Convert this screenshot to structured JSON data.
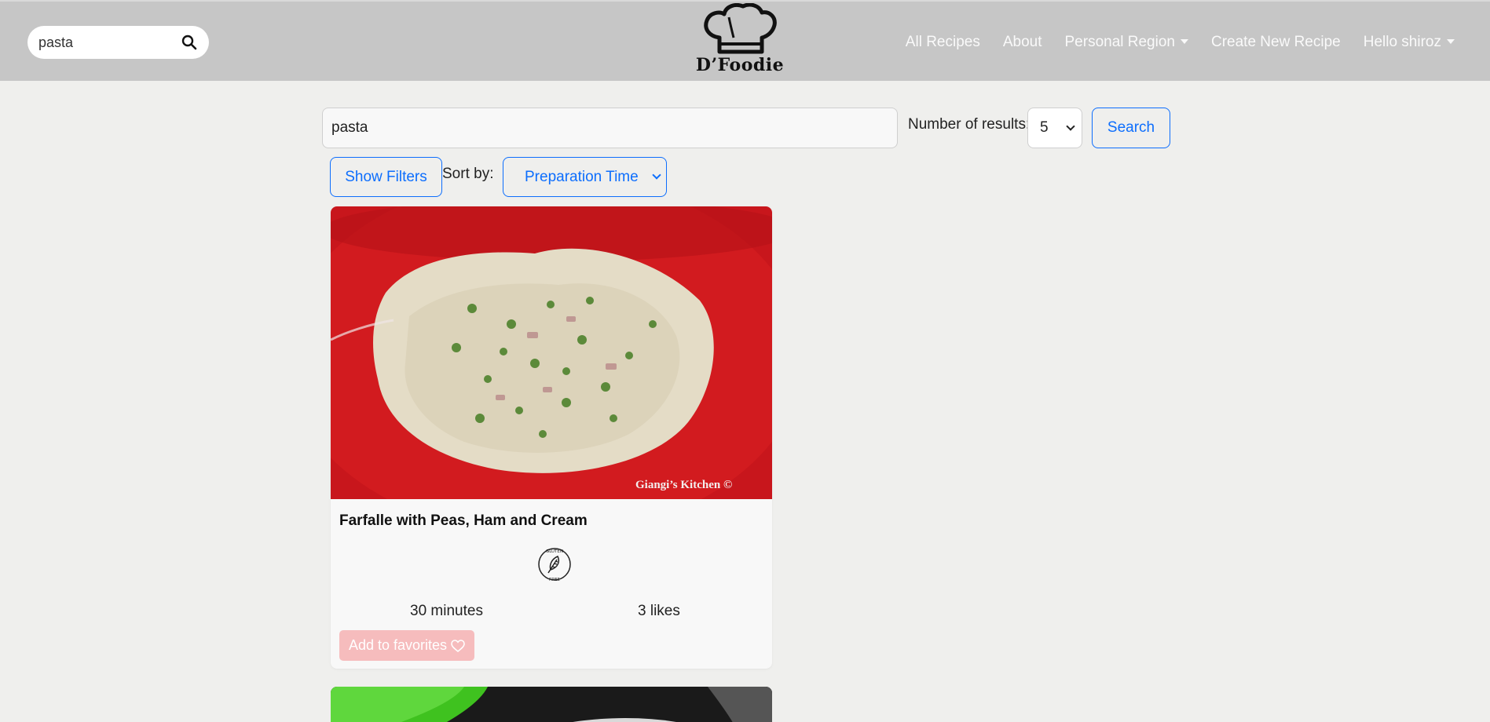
{
  "nav": {
    "search_value": "pasta",
    "brand": "D’Foodie",
    "links": {
      "all_recipes": "All Recipes",
      "about": "About",
      "personal_region": "Personal Region",
      "create_recipe": "Create New Recipe",
      "user_greeting": "Hello shiroz"
    }
  },
  "search": {
    "query": "pasta",
    "num_results_label": "Number of results:",
    "num_results_value": "5",
    "search_label": "Search",
    "show_filters_label": "Show Filters",
    "sort_label": "Sort by:",
    "sort_value": "Preparation Time"
  },
  "results": [
    {
      "title": "Farfalle with Peas, Ham and Cream",
      "image_watermark": "Giangi’s Kitchen ©",
      "badge": "gluten-free-icon",
      "time": "30 minutes",
      "likes": "3 likes",
      "favorite_label": "Add to favorites"
    }
  ],
  "colors": {
    "navbar": "#c6c6c6",
    "page_bg": "#efefed",
    "accent": "#0d6efd",
    "favorite_button": "#f6bcbd"
  }
}
